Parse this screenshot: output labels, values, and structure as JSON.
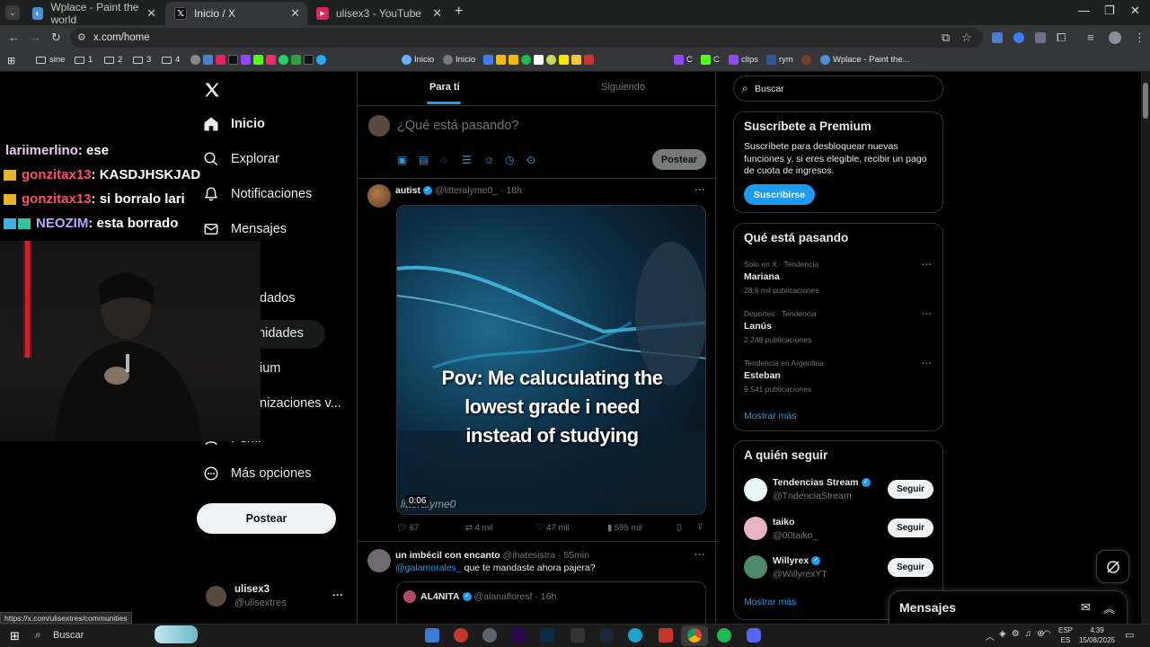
{
  "browser": {
    "tabs": [
      {
        "title": "Wplace - Paint the world",
        "active": false
      },
      {
        "title": "Inicio / X",
        "active": true
      },
      {
        "title": "ulisex3 - YouTube",
        "active": false
      }
    ],
    "new_tab": "+",
    "url": "x.com/home",
    "bookmarks": [
      "sine",
      "1",
      "2",
      "3",
      "4",
      "Inicio",
      "Inicio",
      "C",
      "C",
      "clips",
      "rym",
      "Wplace - Paint the..."
    ],
    "status_url": "https://x.com/ulisextres/communities"
  },
  "nav": {
    "items": [
      "Inicio",
      "Explorar",
      "Notificaciones",
      "Mensajes",
      "dados",
      "unidades",
      "ium",
      "nizaciones v...",
      "Perfil",
      "Más opciones"
    ],
    "post_button": "Postear",
    "account_name": "ulisex3",
    "account_handle": "@ulisextres",
    "more": "···"
  },
  "feed": {
    "tabs": [
      "Para ti",
      "Siguiendo"
    ],
    "compose_placeholder": "¿Qué está pasando?",
    "compose_post": "Postear",
    "tweet1": {
      "name": "autist",
      "handle": "@litteralyme0_",
      "time": "· 18h",
      "video_caption": "Pov: Me caluculating the lowest grade i need instead of studying",
      "watermark": "litteralyme0",
      "duration": "0:06",
      "replies": "67",
      "retweets": "4 mil",
      "likes": "47 mil",
      "views": "595 mil"
    },
    "tweet2": {
      "name": "un imbécil con encanto",
      "handle": "@ihatesistra",
      "time": "· 55min",
      "mention": "@galamorales_",
      "text": "que te mandaste ahora pajera?",
      "quoted_name": "AL4NITA",
      "quoted_handle": "@alanafloresf",
      "quoted_time": "· 16h"
    }
  },
  "sidebar": {
    "search_placeholder": "Buscar",
    "premium": {
      "title": "Suscríbete a Premium",
      "text": "Suscríbete para desbloquear nuevas funciones y, si eres elegible, recibir un pago de cuota de ingresos.",
      "button": "Suscribirse"
    },
    "trends": {
      "title": "Qué está pasando",
      "items": [
        {
          "context": "Solo en X · Tendencia",
          "name": "Mariana",
          "count": "28,6 mil publicaciones"
        },
        {
          "context": "Deportes · Tendencia",
          "name": "Lanús",
          "count": "2.248 publicaciones"
        },
        {
          "context": "Tendencia en Argentina",
          "name": "Esteban",
          "count": "9.541 publicaciones"
        }
      ],
      "more": "Mostrar más"
    },
    "follow": {
      "title": "A quién seguir",
      "items": [
        {
          "name": "Tendencias Stream",
          "handle": "@TndenciaStream",
          "button": "Seguir"
        },
        {
          "name": "taiko",
          "handle": "@00taiko_",
          "button": "Seguir"
        },
        {
          "name": "Willyrex",
          "handle": "@WillyrexYT",
          "button": "Seguir"
        }
      ],
      "more": "Mostrar más"
    },
    "messages_title": "Mensajes"
  },
  "overlay_chat": [
    {
      "user": "lariimerlino",
      "msg": ": ese",
      "color": "#e8c9f0"
    },
    {
      "user": "gonzitax13",
      "msg": ": KASDJHSKJAD",
      "color": "#ff4f6d"
    },
    {
      "user": "gonzitax13",
      "msg": ": si borralo lari",
      "color": "#ff4f6d"
    },
    {
      "user": "NEOZIM",
      "msg": ": esta borrado",
      "color": "#b9a7ff"
    }
  ],
  "taskbar": {
    "search": "Buscar",
    "lang1": "ESP",
    "lang2": "ES",
    "time": "4:39",
    "date": "15/08/2025"
  },
  "colors": {
    "accent": "#1d9bf0",
    "background": "#000000",
    "border": "#2f3336"
  }
}
